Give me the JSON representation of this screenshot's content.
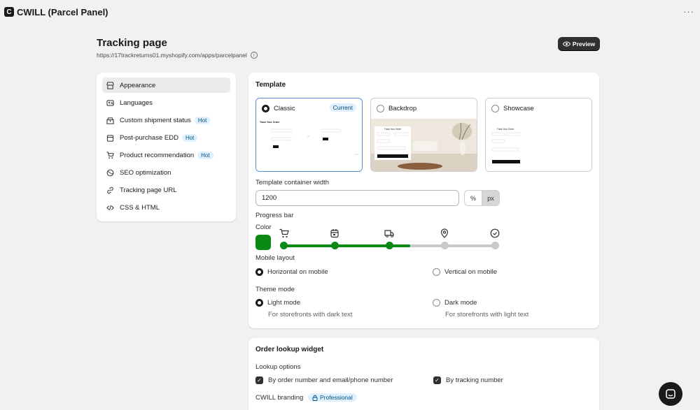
{
  "app": {
    "title": "CWILL (Parcel Panel)",
    "logo_letter": "C",
    "more": "···"
  },
  "page": {
    "title": "Tracking page",
    "url": "https://17trackreturns01.myshopify.com/apps/parcelpanel",
    "preview_label": "Preview"
  },
  "sidebar": {
    "items": [
      {
        "label": "Appearance",
        "icon": "storefront-icon"
      },
      {
        "label": "Languages",
        "icon": "language-icon"
      },
      {
        "label": "Custom shipment status",
        "icon": "package-icon",
        "badge": "Hot"
      },
      {
        "label": "Post-purchase EDD",
        "icon": "calendar-icon",
        "badge": "Hot"
      },
      {
        "label": "Product recommendation",
        "icon": "cart-icon",
        "badge": "Hot"
      },
      {
        "label": "SEO optimization",
        "icon": "globe-icon"
      },
      {
        "label": "Tracking page URL",
        "icon": "link-icon"
      },
      {
        "label": "CSS & HTML",
        "icon": "code-icon"
      }
    ]
  },
  "template_section": {
    "title": "Template",
    "options": [
      {
        "label": "Classic",
        "badge": "Current",
        "thumb_heading": "Track Your Order"
      },
      {
        "label": "Backdrop",
        "thumb_heading": "Track Your Order"
      },
      {
        "label": "Showcase",
        "thumb_heading": "Track Your Order"
      }
    ],
    "width_label": "Template container width",
    "width_value": "1200",
    "unit_percent": "%",
    "unit_px": "px"
  },
  "progress_bar": {
    "label": "Progress bar",
    "color_label": "Color",
    "color": "#0a8a14",
    "inactive_color": "#c9c9c9",
    "progress": 0.6,
    "steps": [
      "cart-icon",
      "calendar-icon",
      "truck-icon",
      "location-pin-icon",
      "check-circle-icon"
    ]
  },
  "mobile_layout": {
    "label": "Mobile layout",
    "horizontal": "Horizontal on mobile",
    "vertical": "Vertical on mobile"
  },
  "theme_mode": {
    "label": "Theme mode",
    "light": "Light mode",
    "light_desc": "For storefronts with dark text",
    "dark": "Dark mode",
    "dark_desc": "For storefronts with light text"
  },
  "order_lookup": {
    "title": "Order lookup widget",
    "options_label": "Lookup options",
    "opt1": "By order number and email/phone number",
    "opt2": "By tracking number",
    "branding_label": "CWILL branding",
    "branding_badge": "Professional"
  }
}
